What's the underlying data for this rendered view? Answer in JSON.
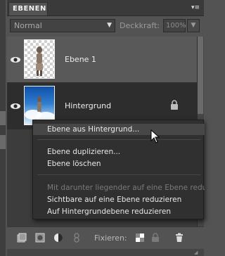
{
  "panel": {
    "tab_label": "EBENEN",
    "menu_button": "▾≡"
  },
  "blend": {
    "mode": "Normal",
    "opacity_label": "Deckkraft:",
    "opacity_value": "100%"
  },
  "layers": [
    {
      "name": "Ebene 1",
      "visible": true,
      "selected": true,
      "locked": false
    },
    {
      "name": "Hintergrund",
      "visible": true,
      "selected": false,
      "locked": true
    }
  ],
  "context_menu": {
    "groups": [
      [
        "Ebene aus Hintergrund..."
      ],
      [
        "Ebene duplizieren...",
        "Ebene löschen"
      ],
      [
        "Mit darunter liegender auf eine Ebene reduzieren",
        "Sichtbare auf eine Ebene reduzieren",
        "Auf Hintergrundebene reduzieren"
      ]
    ],
    "highlighted": "Ebene aus Hintergrund...",
    "disabled": [
      "Mit darunter liegender auf eine Ebene reduzieren"
    ]
  },
  "toolbar": {
    "fix_label": "Fixieren:"
  },
  "colors": {
    "panel_bg": "#535353",
    "selected_layer": "#595959",
    "unselected_layer": "#2d2d2d",
    "menu_bg": "#303030"
  }
}
